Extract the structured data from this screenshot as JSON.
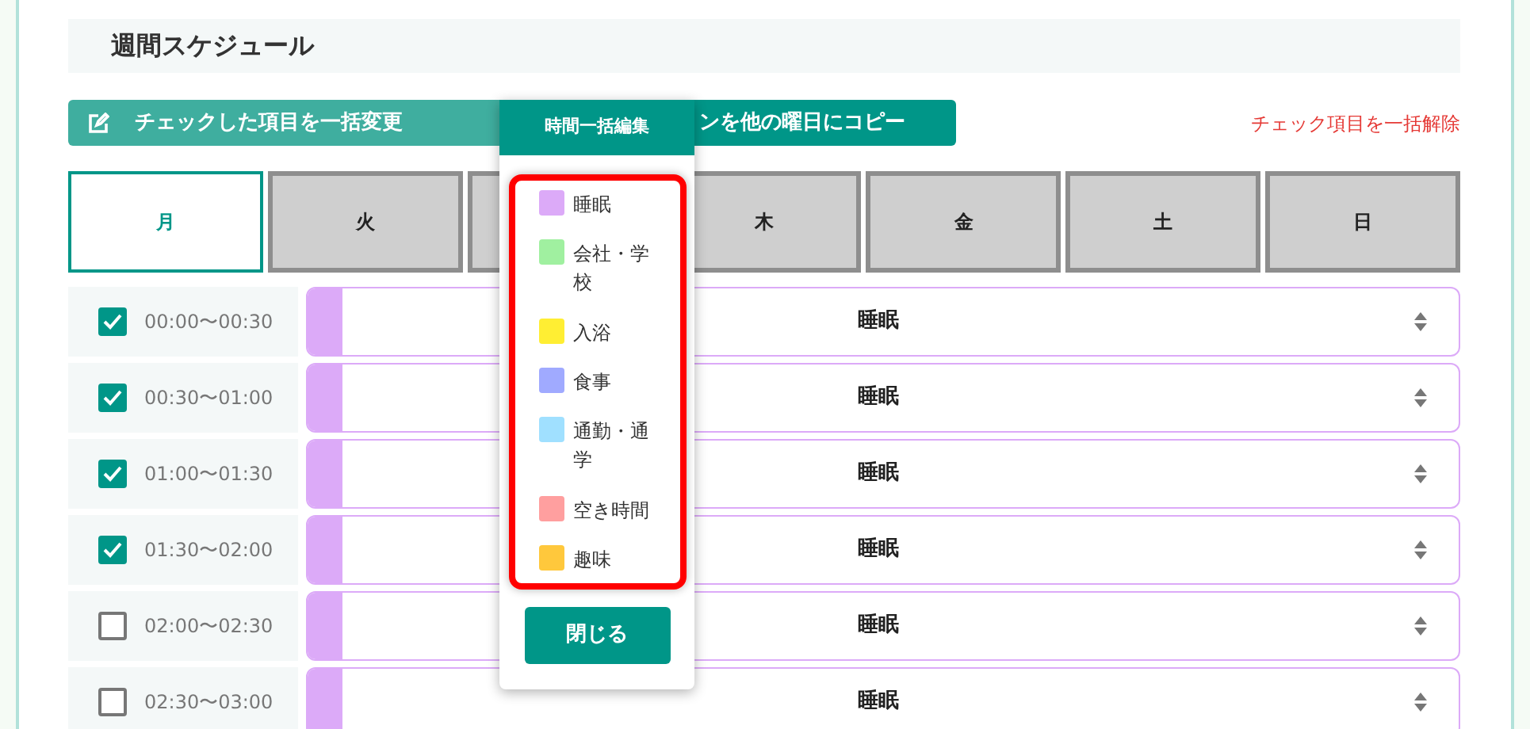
{
  "header": {
    "title": "週間スケジュール"
  },
  "actions": [
    {
      "kind": "edit",
      "label": "チェックした項目を一括変更"
    },
    {
      "kind": "copy",
      "label": "ンを他の曜日にコピー"
    }
  ],
  "clear_link": "チェック項目を一括解除",
  "day_tabs": [
    {
      "label": "月",
      "selected": true
    },
    {
      "label": "火",
      "selected": false
    },
    {
      "selected": false
    },
    {
      "label": "木",
      "selected": false
    },
    {
      "label": "金",
      "selected": false
    },
    {
      "label": "土",
      "selected": false
    },
    {
      "label": "日",
      "selected": false
    }
  ],
  "rows": [
    {
      "time": "00:00〜00:30",
      "checked": true,
      "activity": "睡眠",
      "color": "#dcaaf8"
    },
    {
      "time": "00:30〜01:00",
      "checked": true,
      "activity": "睡眠",
      "color": "#dcaaf8"
    },
    {
      "time": "01:00〜01:30",
      "checked": true,
      "activity": "睡眠",
      "color": "#dcaaf8"
    },
    {
      "time": "01:30〜02:00",
      "checked": true,
      "activity": "睡眠",
      "color": "#dcaaf8"
    },
    {
      "time": "02:00〜02:30",
      "checked": false,
      "activity": "睡眠",
      "color": "#dcaaf8"
    },
    {
      "time": "02:30〜03:00",
      "checked": false,
      "activity": "睡眠",
      "color": "#dcaaf8"
    }
  ],
  "popup": {
    "title": "時間一括編集",
    "legend": [
      {
        "label": "睡眠",
        "color": "#dcaaf8"
      },
      {
        "label": "会社・学校",
        "color": "#a0f0a0"
      },
      {
        "label": "入浴",
        "color": "#ffee33"
      },
      {
        "label": "食事",
        "color": "#a0aaff"
      },
      {
        "label": "通勤・通学",
        "color": "#a0e0ff"
      },
      {
        "label": "空き時間",
        "color": "#ff9f9f"
      },
      {
        "label": "趣味",
        "color": "#ffc83c"
      }
    ],
    "close_button": "閉じる"
  }
}
